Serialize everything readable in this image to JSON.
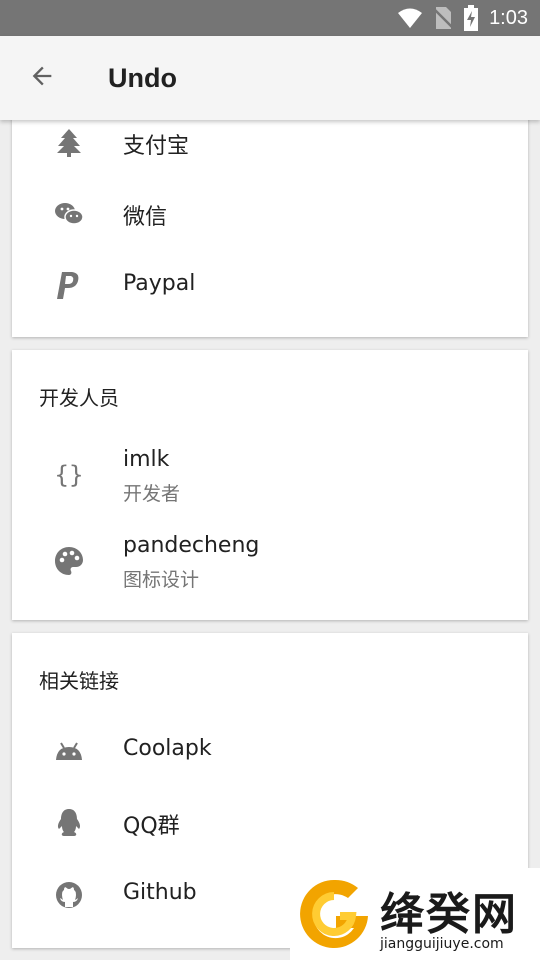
{
  "status_bar": {
    "time": "1:03"
  },
  "app_bar": {
    "title": "Undo"
  },
  "donate": {
    "items": [
      {
        "label": "支付宝",
        "icon": "tree-icon"
      },
      {
        "label": "微信",
        "icon": "wechat-icon"
      },
      {
        "label": "Paypal",
        "icon": "paypal-icon"
      }
    ]
  },
  "developers": {
    "title": "开发人员",
    "items": [
      {
        "name": "imlk",
        "role": "开发者",
        "icon": "code-braces-icon"
      },
      {
        "name": "pandecheng",
        "role": "图标设计",
        "icon": "palette-icon"
      }
    ]
  },
  "links": {
    "title": "相关链接",
    "items": [
      {
        "label": "Coolapk",
        "icon": "android-icon"
      },
      {
        "label": "QQ群",
        "icon": "qq-icon"
      },
      {
        "label": "Github",
        "icon": "github-icon"
      }
    ]
  },
  "watermark": {
    "name": "绛癸网",
    "url": "jiangguijiuye.com"
  },
  "colors": {
    "status_bar": "#757575",
    "app_bar": "#f5f5f5",
    "icon": "#757575",
    "background": "#eeeeee"
  }
}
